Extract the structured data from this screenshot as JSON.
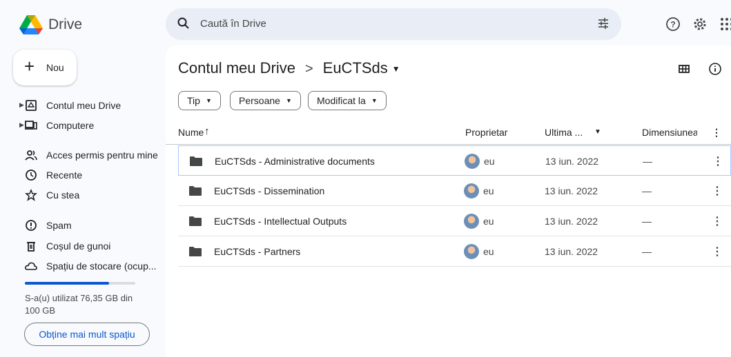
{
  "app": {
    "brand": "Drive"
  },
  "search": {
    "placeholder": "Caută în Drive"
  },
  "sidebar": {
    "new_label": "Nou",
    "items": [
      {
        "label": "Contul meu Drive"
      },
      {
        "label": "Computere"
      },
      {
        "label": "Acces permis pentru mine"
      },
      {
        "label": "Recente"
      },
      {
        "label": "Cu stea"
      },
      {
        "label": "Spam"
      },
      {
        "label": "Coșul de gunoi"
      },
      {
        "label": "Spațiu de stocare (ocup..."
      }
    ],
    "storage": {
      "used_fraction": 0.7635,
      "text": "S-a(u) utilizat 76,35 GB din 100 GB",
      "button": "Obține mai mult spațiu"
    }
  },
  "breadcrumb": {
    "root": "Contul meu Drive",
    "separator": ">",
    "current": "EuCTSds"
  },
  "filters": {
    "type": "Tip",
    "people": "Persoane",
    "modified": "Modificat la"
  },
  "table": {
    "headers": {
      "name": "Nume",
      "owner": "Proprietar",
      "modified": "Ultima ...",
      "size": "Dimensiunea"
    },
    "rows": [
      {
        "name": "EuCTSds - Administrative documents",
        "owner": "eu",
        "date": "13 iun. 2022",
        "size": "—"
      },
      {
        "name": "EuCTSds - Dissemination",
        "owner": "eu",
        "date": "13 iun. 2022",
        "size": "—"
      },
      {
        "name": "EuCTSds - Intellectual Outputs",
        "owner": "eu",
        "date": "13 iun. 2022",
        "size": "—"
      },
      {
        "name": "EuCTSds - Partners",
        "owner": "eu",
        "date": "13 iun. 2022",
        "size": "—"
      }
    ]
  },
  "colors": {
    "accent": "#0b57d0",
    "background": "#f8fafd",
    "search_bg": "#e9eef6"
  }
}
